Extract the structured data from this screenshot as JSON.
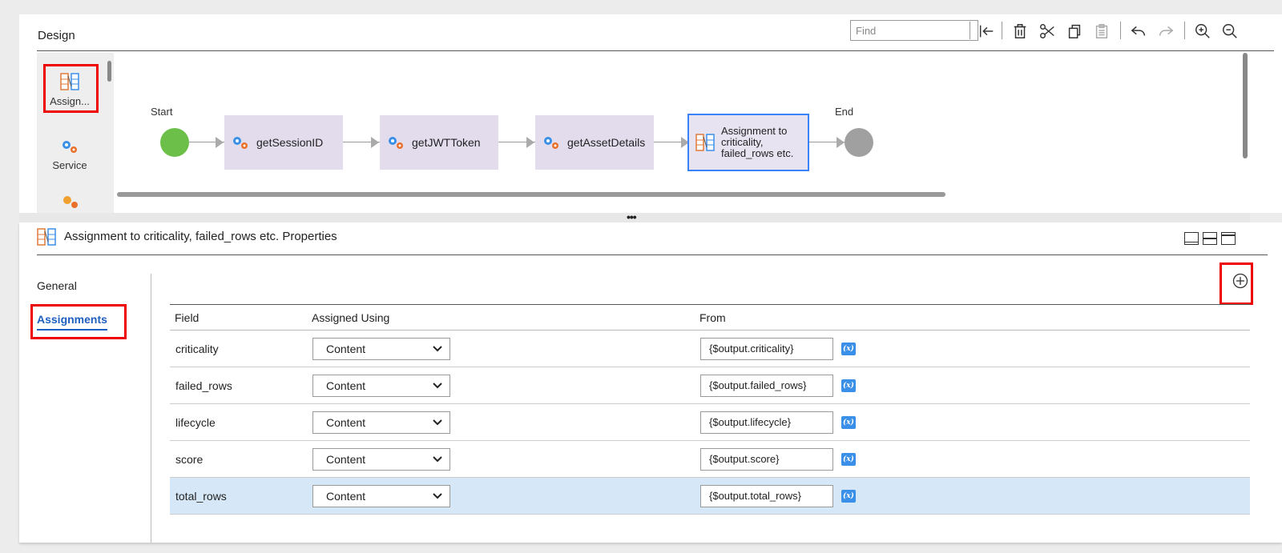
{
  "design": {
    "title": "Design",
    "find_placeholder": "Find",
    "toolbar": [
      "first-icon",
      "delete-icon",
      "cut-icon",
      "copy-icon",
      "paste-icon",
      "undo-icon",
      "redo-icon",
      "zoom-in-icon",
      "zoom-out-icon"
    ],
    "palette": [
      {
        "label": "Assign...",
        "icon": "assignment-icon"
      },
      {
        "label": "Service",
        "icon": "service-icon"
      }
    ],
    "start_label": "Start",
    "end_label": "End",
    "steps": [
      {
        "label": "getSessionID",
        "icon": "service-icon"
      },
      {
        "label": "getJWTToken",
        "icon": "service-icon"
      },
      {
        "label": "getAssetDetails",
        "icon": "service-icon"
      },
      {
        "label": "Assignment to criticality, failed_rows etc.",
        "icon": "assignment-icon"
      }
    ],
    "start_color": "#6cc04a",
    "end_color": "#a0a0a0"
  },
  "properties": {
    "title": "Assignment to criticality, failed_rows etc. Properties",
    "tabs": {
      "general": "General",
      "assignments": "Assignments"
    },
    "columns": {
      "field": "Field",
      "assigned_using": "Assigned Using",
      "from": "From"
    },
    "rows": [
      {
        "field": "criticality",
        "assigned_using": "Content",
        "from": "{$output.criticality}",
        "fx": "(x)"
      },
      {
        "field": "failed_rows",
        "assigned_using": "Content",
        "from": "{$output.failed_rows}",
        "fx": "(x)"
      },
      {
        "field": "lifecycle",
        "assigned_using": "Content",
        "from": "{$output.lifecycle}",
        "fx": "(x)"
      },
      {
        "field": "score",
        "assigned_using": "Content",
        "from": "{$output.score}",
        "fx": "(x)"
      },
      {
        "field": "total_rows",
        "assigned_using": "Content",
        "from": "{$output.total_rows}",
        "fx": "(x)"
      }
    ],
    "accent_color": "#1f5fbf",
    "highlight_color": "#d6e8f7"
  }
}
